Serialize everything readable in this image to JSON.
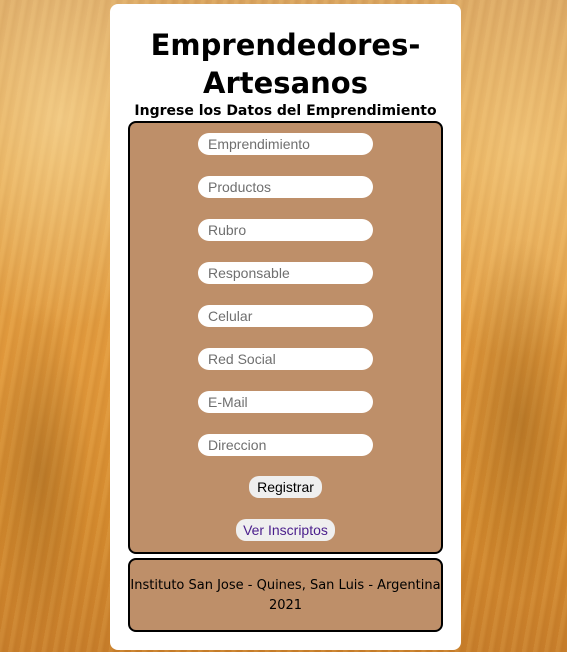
{
  "header": {
    "title_line1": "Emprendedores-",
    "title_line2": "Artesanos",
    "subtitle": "Ingrese los Datos del Emprendimiento"
  },
  "form": {
    "fields": [
      {
        "placeholder": "Emprendimiento",
        "value": ""
      },
      {
        "placeholder": "Productos",
        "value": ""
      },
      {
        "placeholder": "Rubro",
        "value": ""
      },
      {
        "placeholder": "Responsable",
        "value": ""
      },
      {
        "placeholder": "Celular",
        "value": ""
      },
      {
        "placeholder": "Red Social",
        "value": ""
      },
      {
        "placeholder": "E-Mail",
        "value": ""
      },
      {
        "placeholder": "Direccion",
        "value": ""
      }
    ],
    "register_label": "Registrar",
    "view_label": "Ver Inscriptos"
  },
  "footer": {
    "line1": "Instituto San Jose - Quines, San Luis - Argentina",
    "line2": "2021"
  },
  "colors": {
    "card_background": "#ffffff",
    "form_background": "#be8f69",
    "border": "#000000",
    "link_text": "#4a1e8c"
  }
}
